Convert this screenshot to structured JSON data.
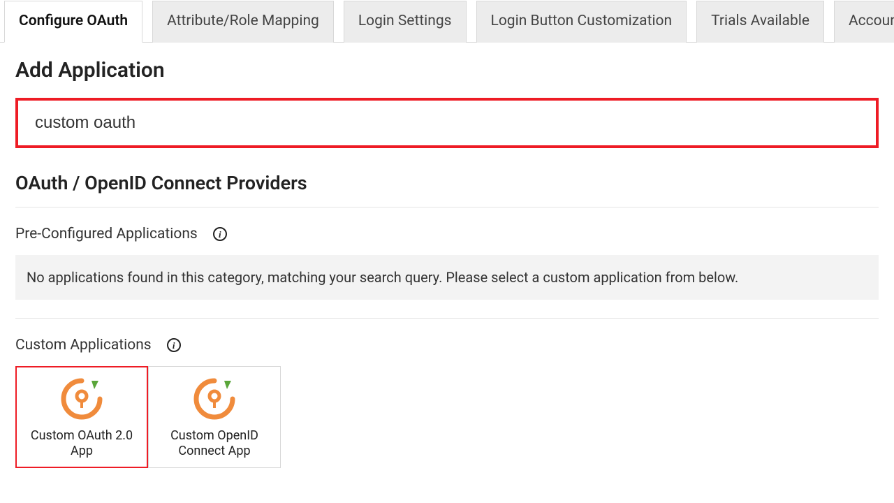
{
  "tabs": [
    {
      "label": "Configure OAuth",
      "active": true
    },
    {
      "label": "Attribute/Role Mapping",
      "active": false
    },
    {
      "label": "Login Settings",
      "active": false
    },
    {
      "label": "Login Button Customization",
      "active": false
    },
    {
      "label": "Trials Available",
      "active": false
    },
    {
      "label": "Account Setu",
      "active": false
    }
  ],
  "page": {
    "title": "Add Application",
    "search_value": "custom oauth",
    "providers_heading": "OAuth / OpenID Connect Providers",
    "preconfigured_heading": "Pre-Configured Applications",
    "empty_message": "No applications found in this category, matching your search query. Please select a custom application from below.",
    "custom_heading": "Custom Applications",
    "custom_apps": [
      {
        "label": "Custom OAuth 2.0 App",
        "selected": true
      },
      {
        "label": "Custom OpenID Connect App",
        "selected": false
      }
    ]
  },
  "icons": {
    "info_glyph": "i"
  }
}
